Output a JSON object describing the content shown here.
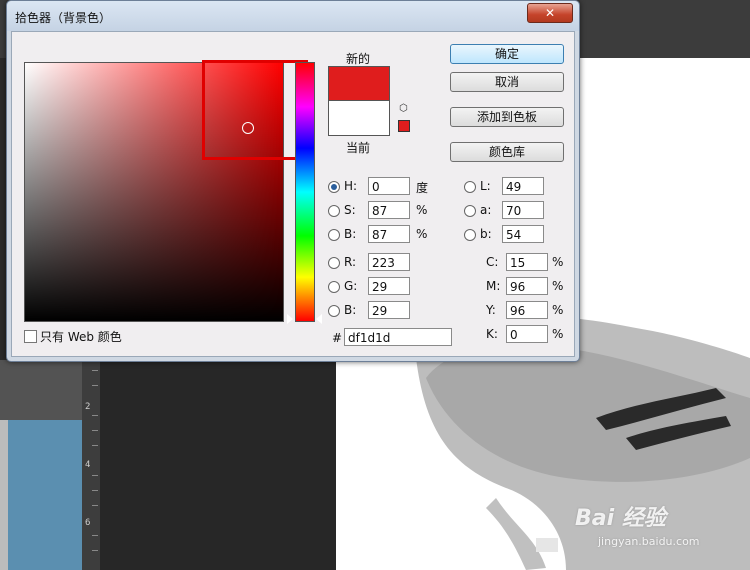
{
  "dialog": {
    "title": "拾色器（背景色）",
    "close_glyph": "✕"
  },
  "swatches": {
    "new_label": "新的",
    "current_label": "当前",
    "new_color": "#df1d1d",
    "current_color": "#ffffff"
  },
  "buttons": {
    "ok": "确定",
    "cancel": "取消",
    "add_to_swatches": "添加到色板",
    "color_libraries": "颜色库"
  },
  "web_colors_label": "只有 Web 颜色",
  "hsb": [
    {
      "label": "H:",
      "value": "0",
      "unit": "度",
      "selected": true
    },
    {
      "label": "S:",
      "value": "87",
      "unit": "%",
      "selected": false
    },
    {
      "label": "B:",
      "value": "87",
      "unit": "%",
      "selected": false
    }
  ],
  "rgb": [
    {
      "label": "R:",
      "value": "223"
    },
    {
      "label": "G:",
      "value": "29"
    },
    {
      "label": "B:",
      "value": "29"
    }
  ],
  "lab": [
    {
      "label": "L:",
      "value": "49"
    },
    {
      "label": "a:",
      "value": "70"
    },
    {
      "label": "b:",
      "value": "54"
    }
  ],
  "cmyk": [
    {
      "label": "C:",
      "value": "15",
      "unit": "%"
    },
    {
      "label": "M:",
      "value": "96",
      "unit": "%"
    },
    {
      "label": "Y:",
      "value": "96",
      "unit": "%"
    },
    {
      "label": "K:",
      "value": "0",
      "unit": "%"
    }
  ],
  "hex": {
    "label": "#",
    "value": "df1d1d"
  },
  "ruler": {
    "labels": [
      "2",
      "4",
      "6"
    ]
  },
  "watermark": {
    "main": "Bai 经验",
    "sub": "jingyan.baidu.com"
  }
}
